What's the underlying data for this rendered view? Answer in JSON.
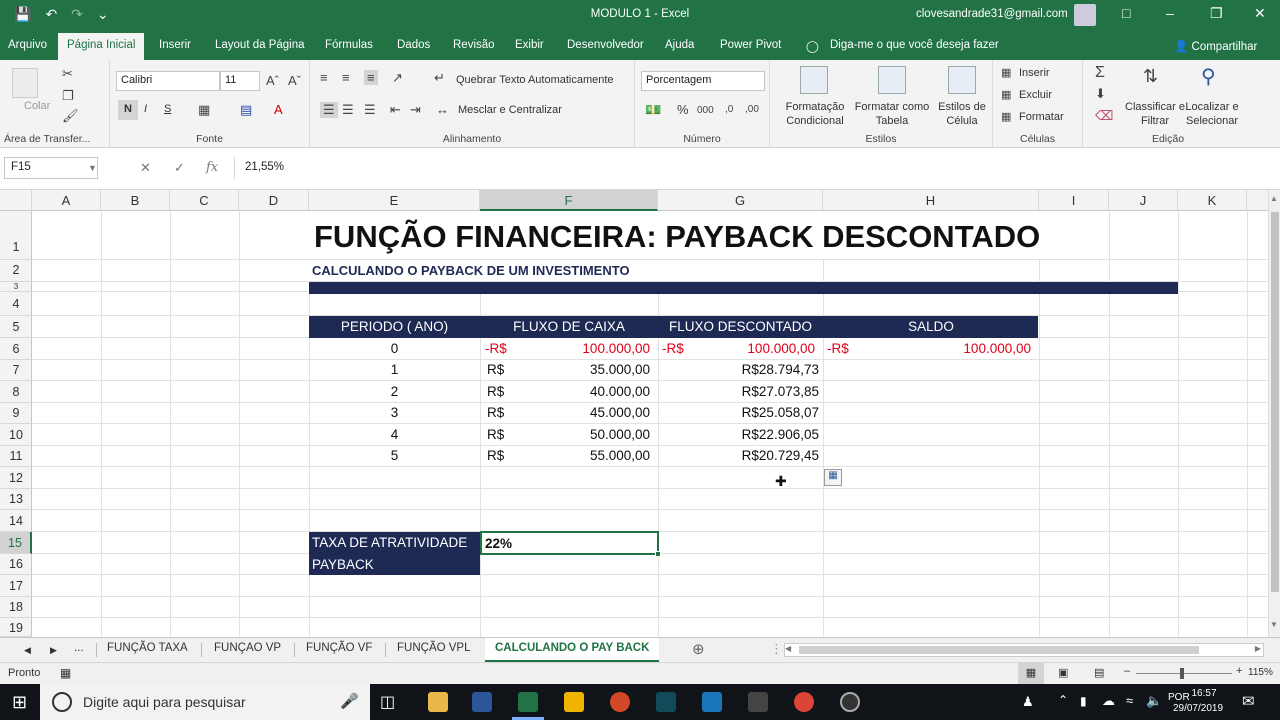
{
  "window": {
    "title": "MODULO 1  -  Excel",
    "user": "clovesandrade31@gmail.com"
  },
  "menu": {
    "tabs": [
      "Arquivo",
      "Página Inicial",
      "Inserir",
      "Layout da Página",
      "Fórmulas",
      "Dados",
      "Revisão",
      "Exibir",
      "Desenvolvedor",
      "Ajuda",
      "Power Pivot"
    ],
    "tellme": "Diga-me o que você deseja fazer",
    "share": "Compartilhar"
  },
  "ribbon": {
    "clipboard": {
      "paste": "Colar",
      "label": "Área de Transfer..."
    },
    "font": {
      "name": "Calibri",
      "size": "11",
      "bold": "N",
      "italic": "I",
      "underline": "S",
      "label": "Fonte"
    },
    "alignment": {
      "wrap": "Quebrar Texto Automaticamente",
      "merge": "Mesclar e Centralizar",
      "label": "Alinhamento"
    },
    "number": {
      "format": "Porcentagem",
      "label": "Número"
    },
    "styles": {
      "conditional": "Formatação Condicional",
      "table": "Formatar como Tabela",
      "cell": "Estilos de Célula",
      "label": "Estilos"
    },
    "cells": {
      "insert": "Inserir",
      "delete": "Excluir",
      "format": "Formatar",
      "label": "Células"
    },
    "editing": {
      "sort": "Classificar e Filtrar",
      "find": "Localizar e Selecionar",
      "label": "Edição"
    }
  },
  "formula_bar": {
    "name_box": "F15",
    "value": "21,55%"
  },
  "columns": [
    "A",
    "B",
    "C",
    "D",
    "E",
    "F",
    "G",
    "H",
    "I",
    "J",
    "K"
  ],
  "rows": [
    "1",
    "2",
    "3",
    "4",
    "5",
    "6",
    "7",
    "8",
    "9",
    "10",
    "11",
    "12",
    "13",
    "14",
    "15",
    "16",
    "17",
    "18",
    "19"
  ],
  "sheet": {
    "title": "FUNÇÃO FINANCEIRA: PAYBACK DESCONTADO",
    "subtitle": "CALCULANDO O PAYBACK DE UM INVESTIMENTO",
    "headers": [
      "PERIODO ( ANO)",
      "FLUXO DE CAIXA",
      "FLUXO DESCONTADO",
      "SALDO"
    ],
    "table": [
      {
        "period": "0",
        "cur": "-R$",
        "cash": "100.000,00",
        "dcur": "-R$",
        "disc": "100.000,00",
        "scur": "-R$",
        "saldo": "100.000,00"
      },
      {
        "period": "1",
        "cur": "R$",
        "cash": "35.000,00",
        "disc": "R$28.794,73"
      },
      {
        "period": "2",
        "cur": "R$",
        "cash": "40.000,00",
        "disc": "R$27.073,85"
      },
      {
        "period": "3",
        "cur": "R$",
        "cash": "45.000,00",
        "disc": "R$25.058,07"
      },
      {
        "period": "4",
        "cur": "R$",
        "cash": "50.000,00",
        "disc": "R$22.906,05"
      },
      {
        "period": "5",
        "cur": "R$",
        "cash": "55.000,00",
        "disc": "R$20.729,45"
      }
    ],
    "taxa_label": "TAXA DE ATRATIVIDADE",
    "taxa_value": "22%",
    "payback_label": "PAYBACK"
  },
  "sheet_tabs": [
    "...",
    "FUNÇÃO TAXA",
    "FUNÇAO VP",
    "FUNÇÃO VF",
    "FUNÇÃO VPL",
    "CALCULANDO O PAY BACK"
  ],
  "status": {
    "ready": "Pronto",
    "zoom": "115%"
  },
  "taskbar": {
    "search": "Digite aqui para pesquisar",
    "time": "16:57",
    "date": "29/07/2019"
  }
}
